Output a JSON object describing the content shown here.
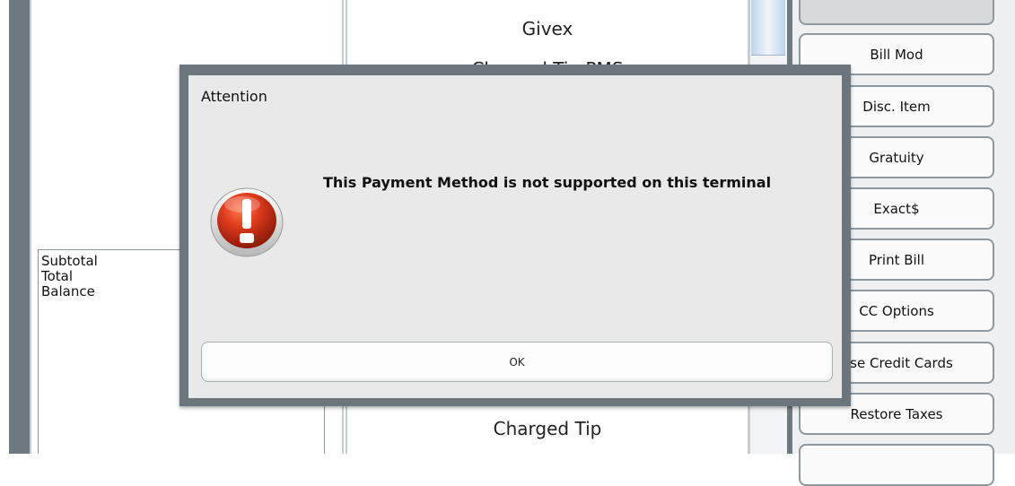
{
  "check": {
    "totals": [
      "Subtotal",
      "Total",
      "Balance"
    ]
  },
  "payments": {
    "top_label": "Givex",
    "partial_label": "Charged Tip PMS",
    "bottom_label": "Charged Tip"
  },
  "side_buttons": [
    "",
    "Bill Mod",
    "Disc. Item",
    "Gratuity",
    "Exact$",
    "Print Bill",
    "CC Options",
    "Use Credit Cards",
    "Restore Taxes",
    ""
  ],
  "dialog": {
    "title": "Attention",
    "message": "This Payment Method is not supported on this terminal",
    "ok_label": "OK",
    "icon": "exclamation-alert-icon"
  },
  "colors": {
    "frame": "#6f7a80",
    "dialog_body": "#e9e9e9",
    "alert_red": "#d3321a"
  }
}
